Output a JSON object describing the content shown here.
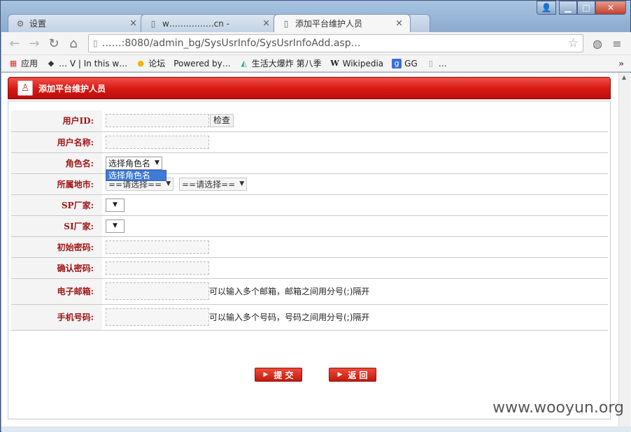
{
  "window": {
    "controls": {
      "user": "👤",
      "minimize": "▁",
      "maximize": "□",
      "close": "✕"
    }
  },
  "tabs": [
    {
      "title": "设置",
      "icon": "gear-icon",
      "close": "×",
      "active": false
    },
    {
      "title": "w…………….cn -",
      "icon": "page-icon",
      "close": "×",
      "active": false
    },
    {
      "title": "添加平台维护人员",
      "icon": "page-icon",
      "close": "×",
      "active": true
    }
  ],
  "toolbar": {
    "back": "←",
    "forward": "→",
    "reload": "↻",
    "home": "⌂",
    "url": "……:8080/admin_bg/SysUsrInfo/SysUsrInfoAdd.asp…",
    "star": "☆",
    "globe": "◍",
    "menu": "≡"
  },
  "bookmarks": {
    "items": [
      {
        "label": "应用",
        "icon": "apps-icon"
      },
      {
        "label": "…  V | In this w…",
        "icon": "bookmark-icon"
      },
      {
        "label": "论坛",
        "icon": "forum-icon"
      },
      {
        "label": "Powered by…",
        "icon": "bookmark-icon"
      },
      {
        "label": "生活大爆炸 第八季",
        "icon": "bookmark-icon"
      },
      {
        "label": "Wikipedia",
        "icon": "wikipedia-icon"
      },
      {
        "label": "GG",
        "icon": "google-icon"
      },
      {
        "label": "…",
        "icon": "bookmark-icon"
      }
    ],
    "overflow": "»"
  },
  "page": {
    "title": "添加平台维护人员",
    "form": {
      "user_id_label": "用户ID:",
      "check_button": "检查",
      "user_name_label": "用户名称:",
      "role_label": "角色名:",
      "role_selected": "选择角色名",
      "role_option_highlight": "选择角色名",
      "region_label": "所属地市:",
      "region_select_1": "==请选择==",
      "region_select_2": "==请选择==",
      "sp_label": "SP厂家:",
      "si_label": "SI厂家:",
      "init_password_label": "初始密码:",
      "confirm_password_label": "确认密码:",
      "email_label": "电子邮箱:",
      "email_hint": "可以输入多个邮箱，邮箱之间用分号(;)隔开",
      "phone_label": "手机号码:",
      "phone_hint": "可以输入多个号码，号码之间用分号(;)隔开"
    },
    "submit_label": "提 交",
    "back_label": "返 回"
  },
  "watermark": "www.wooyun.org"
}
